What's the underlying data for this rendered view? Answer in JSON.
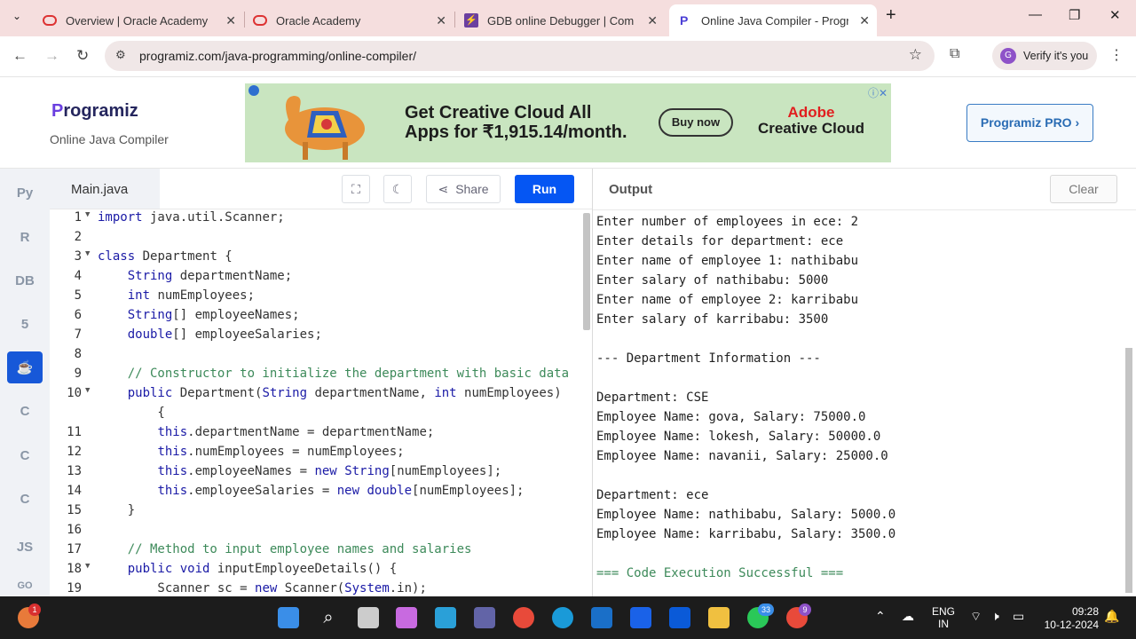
{
  "browser": {
    "tabs": [
      {
        "title": "Overview | Oracle Academy",
        "favicon": "oracle-ring-icon"
      },
      {
        "title": "Oracle Academy",
        "favicon": "oracle-ring-icon"
      },
      {
        "title": "GDB online Debugger | Compile",
        "favicon": "gdb-icon"
      },
      {
        "title": "Online Java Compiler - Program",
        "favicon": "programiz-icon"
      }
    ],
    "url": "programiz.com/java-programming/online-compiler/",
    "verify_label": "Verify it's you",
    "avatar_letter": "G"
  },
  "header": {
    "logo_text": "rogramiz",
    "logo_letter": "P",
    "subtitle": "Online Java Compiler",
    "pro_label": "Programiz PRO ›",
    "ad": {
      "line1": "Get Creative Cloud All",
      "line2": "Apps for ₹1,915.14/month.",
      "button": "Buy now",
      "brand1": "Adobe",
      "brand2": "Creative Cloud"
    }
  },
  "sidebar": {
    "items": [
      {
        "icon": "python-icon",
        "label": "Py"
      },
      {
        "icon": "r-icon",
        "label": "R"
      },
      {
        "icon": "database-icon",
        "label": "DB"
      },
      {
        "icon": "html5-icon",
        "label": "5"
      },
      {
        "icon": "java-icon",
        "label": "☕"
      },
      {
        "icon": "c-icon",
        "label": "C"
      },
      {
        "icon": "cpp-icon",
        "label": "C"
      },
      {
        "icon": "csharp-icon",
        "label": "C"
      },
      {
        "icon": "js-icon",
        "label": "JS"
      },
      {
        "icon": "go-icon",
        "label": "GO"
      }
    ],
    "active_index": 4
  },
  "editor": {
    "filename": "Main.java",
    "share_label": "Share",
    "run_label": "Run",
    "lines": [
      {
        "n": "1",
        "fold": true,
        "html": "<span class=\"kw\">import</span> java.util.Scanner;"
      },
      {
        "n": "2",
        "fold": false,
        "html": ""
      },
      {
        "n": "3",
        "fold": true,
        "html": "<span class=\"kw\">class</span> Department {"
      },
      {
        "n": "4",
        "fold": false,
        "html": "    <span class=\"kw\">String</span> departmentName;"
      },
      {
        "n": "5",
        "fold": false,
        "html": "    <span class=\"kw\">int</span> numEmployees;"
      },
      {
        "n": "6",
        "fold": false,
        "html": "    <span class=\"kw\">String</span>[] employeeNames;"
      },
      {
        "n": "7",
        "fold": false,
        "html": "    <span class=\"kw\">double</span>[] employeeSalaries;"
      },
      {
        "n": "8",
        "fold": false,
        "html": ""
      },
      {
        "n": "9",
        "fold": false,
        "html": "    <span class=\"cm\">// Constructor to initialize the department with basic data</span>"
      },
      {
        "n": "10",
        "fold": true,
        "html": "    <span class=\"kw\">public</span> Department(<span class=\"kw\">String</span> departmentName, <span class=\"kw\">int</span> numEmployees)"
      },
      {
        "n": "",
        "fold": false,
        "html": "        {"
      },
      {
        "n": "11",
        "fold": false,
        "html": "        <span class=\"kw\">this</span>.departmentName = departmentName;"
      },
      {
        "n": "12",
        "fold": false,
        "html": "        <span class=\"kw\">this</span>.numEmployees = numEmployees;"
      },
      {
        "n": "13",
        "fold": false,
        "html": "        <span class=\"kw\">this</span>.employeeNames = <span class=\"kw\">new</span> <span class=\"kw\">String</span>[numEmployees];"
      },
      {
        "n": "14",
        "fold": false,
        "html": "        <span class=\"kw\">this</span>.employeeSalaries = <span class=\"kw\">new</span> <span class=\"kw\">double</span>[numEmployees];"
      },
      {
        "n": "15",
        "fold": false,
        "html": "    }"
      },
      {
        "n": "16",
        "fold": false,
        "html": ""
      },
      {
        "n": "17",
        "fold": false,
        "html": "    <span class=\"cm\">// Method to input employee names and salaries</span>"
      },
      {
        "n": "18",
        "fold": true,
        "html": "    <span class=\"kw\">public</span> <span class=\"kw\">void</span> inputEmployeeDetails() {"
      },
      {
        "n": "19",
        "fold": false,
        "html": "        Scanner sc = <span class=\"kw\">new</span> Scanner(<span class=\"kw\">System</span>.in);"
      }
    ]
  },
  "output": {
    "title": "Output",
    "clear_label": "Clear",
    "lines": [
      "Enter number of employees in ece: 2",
      "Enter details for department: ece",
      "Enter name of employee 1: nathibabu",
      "Enter salary of nathibabu: 5000",
      "Enter name of employee 2: karribabu",
      "Enter salary of karribabu: 3500",
      "",
      "--- Department Information ---",
      "",
      "Department: CSE",
      "Employee Name: gova, Salary: 75000.0",
      "Employee Name: lokesh, Salary: 50000.0",
      "Employee Name: navanii, Salary: 25000.0",
      "",
      "Department: ece",
      "Employee Name: nathibabu, Salary: 5000.0",
      "Employee Name: karribabu, Salary: 3500.0",
      ""
    ],
    "success": "=== Code Execution Successful ==="
  },
  "taskbar": {
    "weather_badge": "1",
    "whatsapp_badge": "33",
    "chrome_badge": "9",
    "lang1": "ENG",
    "lang2": "IN",
    "time": "09:28",
    "date": "10-12-2024"
  }
}
